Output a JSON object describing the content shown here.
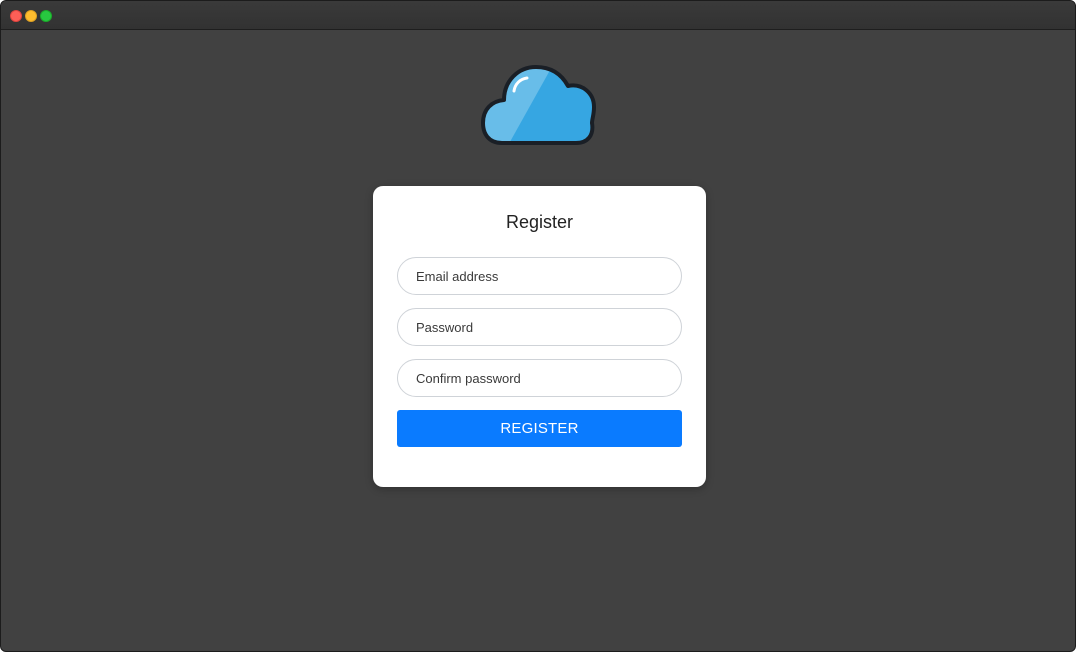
{
  "window": {
    "controls": [
      "close",
      "minimize",
      "maximize"
    ]
  },
  "logo": {
    "icon": "cloud-icon",
    "colors": {
      "light": "#68bde9",
      "dark": "#36a6e2",
      "outline": "#1a1f26"
    }
  },
  "register_form": {
    "title": "Register",
    "email_placeholder": "Email address",
    "email_value": "",
    "password_placeholder": "Password",
    "password_value": "",
    "confirm_placeholder": "Confirm password",
    "confirm_value": "",
    "submit_label": "REGISTER"
  },
  "colors": {
    "background": "#414141",
    "card": "#ffffff",
    "accent": "#0a7bff"
  }
}
